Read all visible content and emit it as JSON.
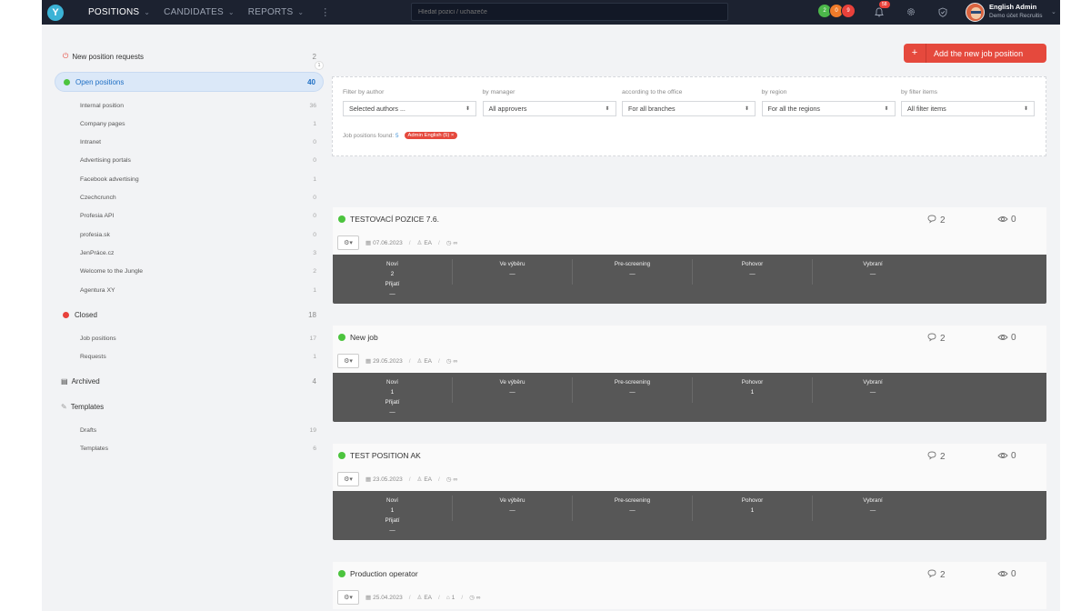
{
  "topbar": {
    "logo": "Y",
    "nav": [
      {
        "label": "POSITIONS",
        "active": true
      },
      {
        "label": "CANDIDATES",
        "active": false
      },
      {
        "label": "REPORTS",
        "active": false
      }
    ],
    "more_icon": "⋮",
    "search_placeholder": "Hledat pozici / uchazeče",
    "counters": [
      {
        "value": "2",
        "color": "#4cb64a"
      },
      {
        "value": "0",
        "color": "#ef7b2a"
      },
      {
        "value": "9",
        "color": "#e8413b"
      }
    ],
    "notifications_count": "58",
    "user": {
      "name": "English Admin",
      "org": "Demo účet Recruitis"
    }
  },
  "sidebar": {
    "new_requests": {
      "label": "New position requests",
      "count": "2",
      "badge": "1"
    },
    "open": {
      "label": "Open positions",
      "count": "40"
    },
    "open_items": [
      {
        "label": "Internal position",
        "count": "36"
      },
      {
        "label": "Company pages",
        "count": "1"
      },
      {
        "label": "Intranet",
        "count": "0"
      },
      {
        "label": "Advertising portals",
        "count": "0"
      },
      {
        "label": "Facebook advertising",
        "count": "1"
      },
      {
        "label": "Czechcrunch",
        "count": "0"
      },
      {
        "label": "Profesia API",
        "count": "0"
      },
      {
        "label": "profesia.sk",
        "count": "0"
      },
      {
        "label": "JenPráce.cz",
        "count": "3"
      },
      {
        "label": "Welcome to the Jungle",
        "count": "2"
      },
      {
        "label": "Agentura XY",
        "count": "1"
      }
    ],
    "closed": {
      "label": "Closed",
      "count": "18"
    },
    "closed_items": [
      {
        "label": "Job positions",
        "count": "17"
      },
      {
        "label": "Requests",
        "count": "1"
      }
    ],
    "archived": {
      "label": "Archived",
      "count": "4"
    },
    "templates": {
      "label": "Templates"
    },
    "templates_items": [
      {
        "label": "Drafts",
        "count": "19"
      },
      {
        "label": "Templates",
        "count": "6"
      }
    ]
  },
  "add_button": {
    "icon": "+",
    "label": "Add the new job position"
  },
  "filters": {
    "fields": [
      {
        "label": "Filter by author",
        "value": "Selected authors ..."
      },
      {
        "label": "by manager",
        "value": "All approvers"
      },
      {
        "label": "according to the office",
        "value": "For all branches"
      },
      {
        "label": "by region",
        "value": "For all the regions"
      },
      {
        "label": "by filter items",
        "value": "All filter items"
      }
    ],
    "found_label": "Job positions found:",
    "found_count": "5",
    "active_tag": "Admin English (5) ×"
  },
  "jobs": [
    {
      "title": "TESTOVACÍ POZICE 7.6.",
      "comments": "2",
      "views": "0",
      "date": "07.06.2023",
      "author": "EA",
      "tags": null,
      "duration": "∞",
      "stages": [
        {
          "name": "Noví",
          "value": "2",
          "sub": "Přijatí",
          "sub_value": "—"
        },
        {
          "name": "Ve výběru",
          "value": "—"
        },
        {
          "name": "Pre-screening",
          "value": "—"
        },
        {
          "name": "Pohovor",
          "value": "—"
        },
        {
          "name": "Vybraní",
          "value": "—"
        }
      ]
    },
    {
      "title": "New job",
      "comments": "2",
      "views": "0",
      "date": "29.05.2023",
      "author": "EA",
      "tags": null,
      "duration": "∞",
      "stages": [
        {
          "name": "Noví",
          "value": "1",
          "sub": "Přijatí",
          "sub_value": "—"
        },
        {
          "name": "Ve výběru",
          "value": "—"
        },
        {
          "name": "Pre-screening",
          "value": "—"
        },
        {
          "name": "Pohovor",
          "value": "1"
        },
        {
          "name": "Vybraní",
          "value": "—"
        }
      ]
    },
    {
      "title": "TEST POSITION AK",
      "comments": "2",
      "views": "0",
      "date": "23.05.2023",
      "author": "EA",
      "tags": null,
      "duration": "∞",
      "stages": [
        {
          "name": "Noví",
          "value": "1",
          "sub": "Přijatí",
          "sub_value": "—"
        },
        {
          "name": "Ve výběru",
          "value": "—"
        },
        {
          "name": "Pre-screening",
          "value": "—"
        },
        {
          "name": "Pohovor",
          "value": "1"
        },
        {
          "name": "Vybraní",
          "value": "—"
        }
      ]
    },
    {
      "title": "Production operator",
      "comments": "2",
      "views": "0",
      "date": "25.04.2023",
      "author": "EA",
      "tags": "1",
      "duration": "∞",
      "stages": []
    }
  ]
}
